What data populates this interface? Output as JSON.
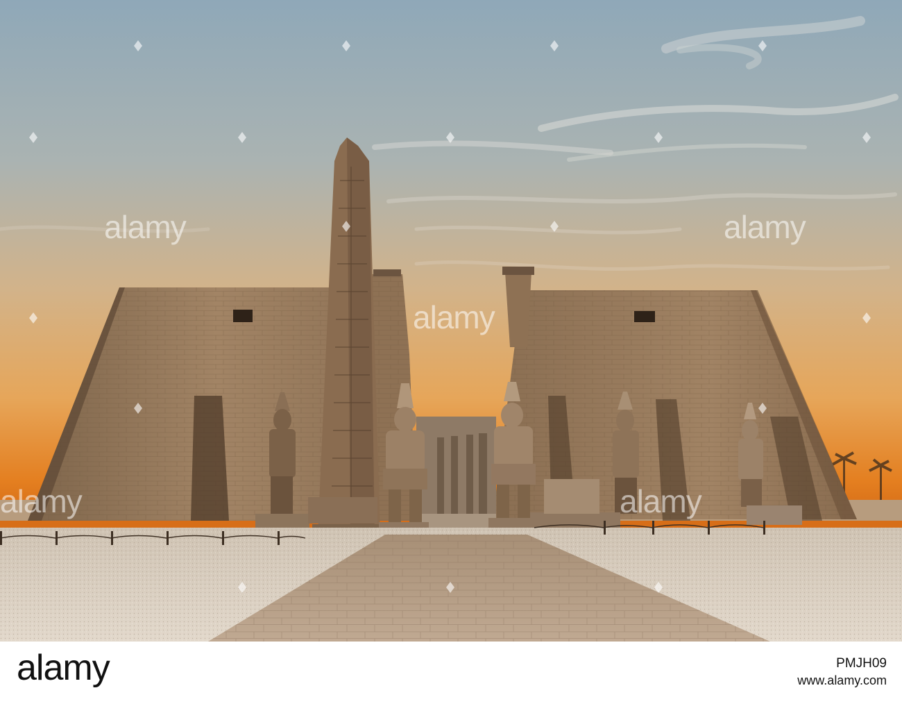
{
  "footer": {
    "brand": "alamy",
    "image_id": "PMJH09",
    "site": "www.alamy.com"
  },
  "watermark": {
    "text": "alamy"
  },
  "colors": {
    "sky_top": "#8fa7b6",
    "sky_mid": "#d9b482",
    "sky_horizon": "#e07a1a",
    "stone": "#9b7d5e",
    "stone_shadow": "#5c4632",
    "ground": "#d9cfc2",
    "pavement": "#b79f86"
  }
}
